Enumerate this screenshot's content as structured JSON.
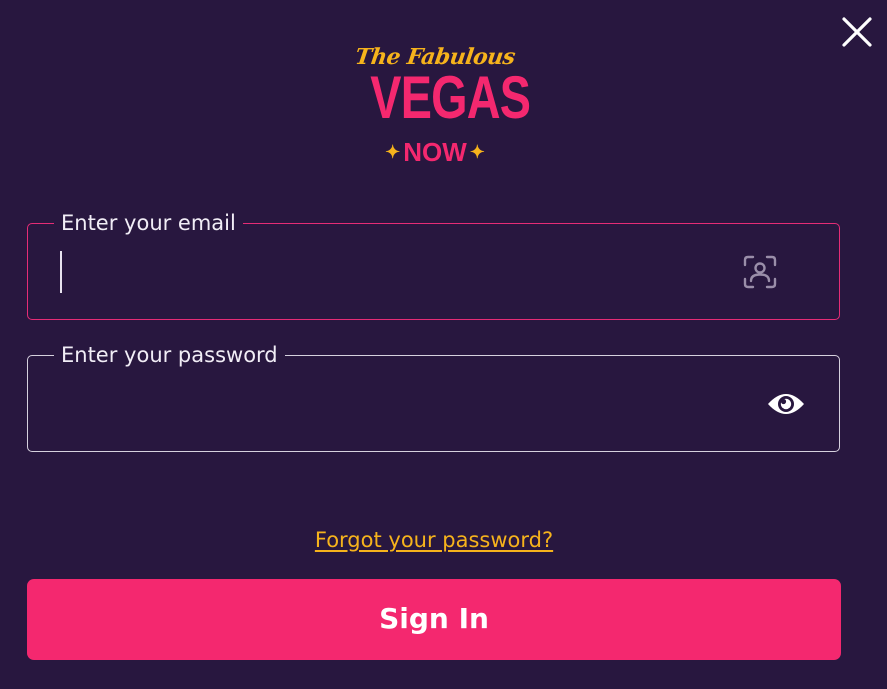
{
  "colors": {
    "background": "#28173f",
    "accent_pink": "#f4286f",
    "accent_gold": "#f6b31c",
    "text": "#f1edf6"
  },
  "close": {
    "icon": "close-icon"
  },
  "logo": {
    "script_text": "The Fabulous",
    "main_text": "VEGAS",
    "sub_text": "NOW",
    "star_glyph": "✦"
  },
  "email_field": {
    "label": "Enter your email",
    "value": "",
    "icon": "face-scan-icon"
  },
  "password_field": {
    "label": "Enter your password",
    "value": "",
    "icon": "eye-icon"
  },
  "forgot_link": "Forgot your password?",
  "signin_button": "Sign In"
}
